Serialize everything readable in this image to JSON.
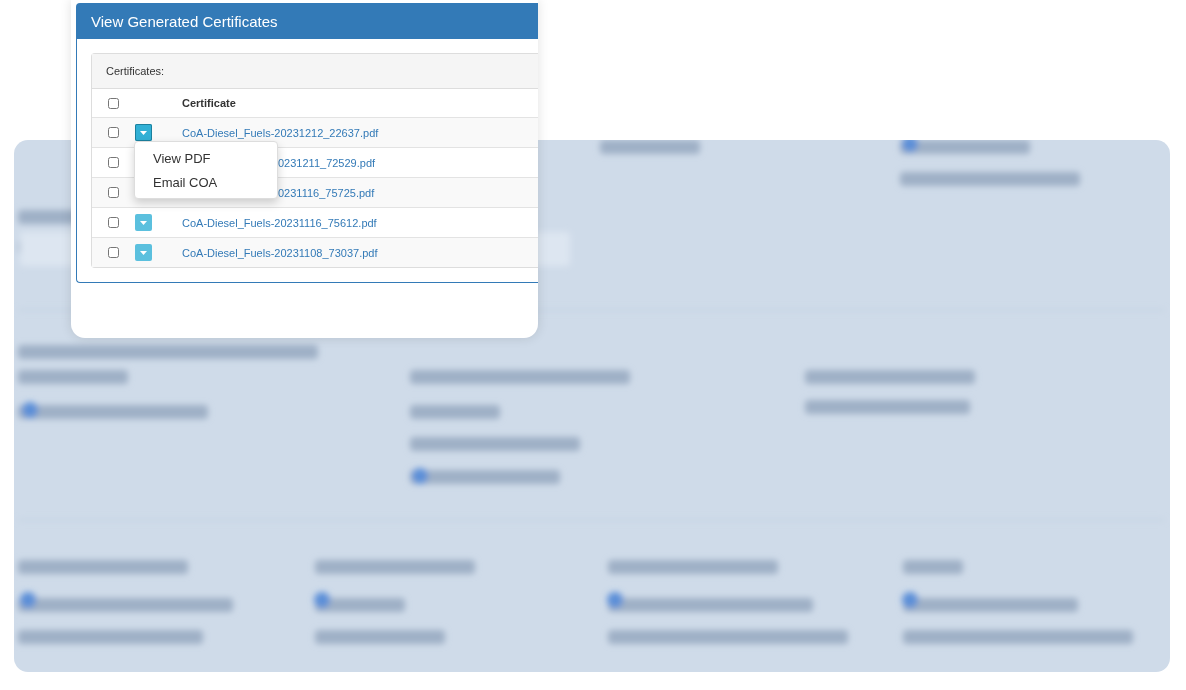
{
  "dialog": {
    "title": "View Generated Certificates",
    "section_label": "Certificates:",
    "select_all_checked": false,
    "column_header": "Certificate",
    "rows": [
      {
        "checked": false,
        "file": "CoA-Diesel_Fuels-20231212_22637.pdf",
        "menu_open": true,
        "covered": false
      },
      {
        "checked": false,
        "file": "0231211_72529.pdf",
        "menu_open": false,
        "covered": true
      },
      {
        "checked": false,
        "file": "0231116_75725.pdf",
        "menu_open": false,
        "covered": true
      },
      {
        "checked": false,
        "file": "CoA-Diesel_Fuels-20231116_75612.pdf",
        "menu_open": false,
        "covered": false
      },
      {
        "checked": false,
        "file": "CoA-Diesel_Fuels-20231108_73037.pdf",
        "menu_open": false,
        "covered": false
      }
    ],
    "menu": [
      "View PDF",
      "Email COA"
    ]
  }
}
